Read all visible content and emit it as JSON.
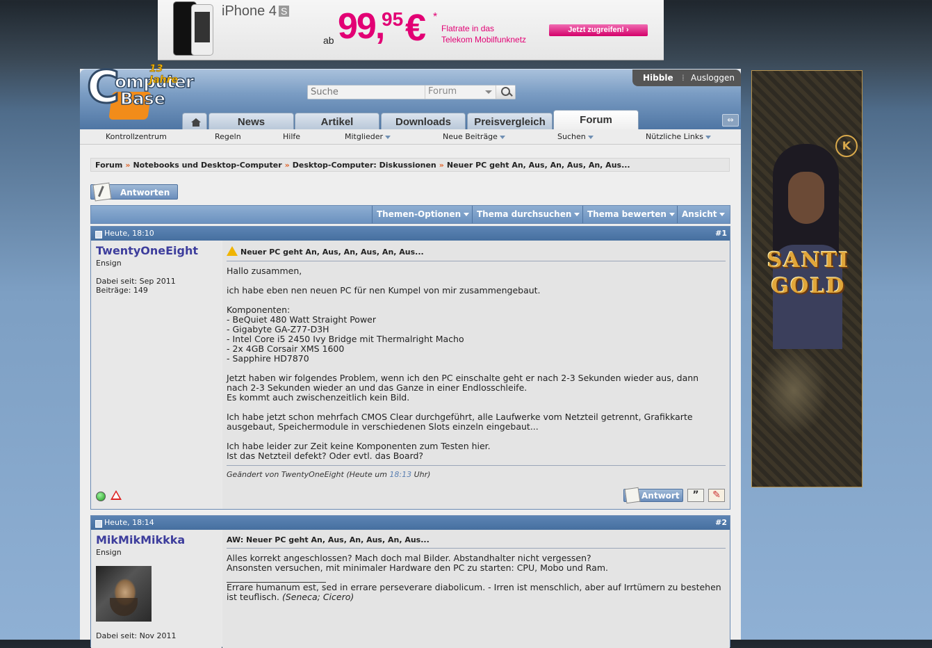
{
  "ad_top": {
    "product": "iPhone 4",
    "product_suffix": "S",
    "price_prefix": "ab",
    "price_main": "99,",
    "price_cents": "95",
    "currency": "€",
    "asterisk": "*",
    "tagline_1": "Flatrate in das",
    "tagline_2": "Telekom Mobilfunknetz",
    "cta": "Jetzt zugreifen!   ›",
    "brand_color": "#e20074"
  },
  "ad_side": {
    "title_line_1": "SANTI",
    "title_line_2": "GOLD",
    "badge": "K"
  },
  "logo": {
    "line_1": "omputer",
    "line_2": "ase",
    "letter_c": "C",
    "letter_b": "B",
    "anniversary": "13 Jahre"
  },
  "search": {
    "placeholder": "Suche",
    "scope": "Forum"
  },
  "user_bar": {
    "username": "Hibble",
    "separator": "⁞",
    "logout": "Ausloggen"
  },
  "main_nav": {
    "tabs": [
      {
        "label": "News"
      },
      {
        "label": "Artikel"
      },
      {
        "label": "Downloads"
      },
      {
        "label": "Preisvergleich"
      },
      {
        "label": "Forum"
      }
    ],
    "expand_icon": "⇔"
  },
  "sub_nav": {
    "items": [
      {
        "label": "Kontrollzentrum"
      },
      {
        "label": "Regeln"
      },
      {
        "label": "Hilfe"
      },
      {
        "label": "Mitglieder"
      },
      {
        "label": "Neue Beiträge"
      },
      {
        "label": "Suchen"
      },
      {
        "label": "Nützliche Links"
      }
    ]
  },
  "breadcrumb": {
    "separator": "»",
    "items": [
      {
        "label": "Forum"
      },
      {
        "label": "Notebooks und Desktop-Computer"
      },
      {
        "label": "Desktop-Computer: Diskussionen"
      },
      {
        "label": "Neuer PC geht An, Aus, An, Aus, An, Aus..."
      }
    ]
  },
  "reply_button": "Antworten",
  "thread_tools": [
    {
      "label": "Themen-Optionen"
    },
    {
      "label": "Thema durchsuchen"
    },
    {
      "label": "Thema bewerten"
    },
    {
      "label": "Ansicht"
    }
  ],
  "posts": [
    {
      "date": "Heute, 18:10",
      "number": "#1",
      "username": "TwentyOneEight",
      "rank": "Ensign",
      "joined": "Dabei seit: Sep 2011",
      "post_count": "Beiträge: 149",
      "title": "Neuer PC geht An, Aus, An, Aus, An, Aus...",
      "body": "Hallo zusammen,\n\nich habe eben nen neuen PC für nen Kumpel von mir zusammengebaut.\n\nKomponenten:\n- BeQuiet 480 Watt Straight Power\n- Gigabyte GA-Z77-D3H\n- Intel Core i5 2450 Ivy Bridge mit Thermalright Macho\n- 2x 4GB Corsair XMS 1600\n- Sapphire HD7870\n\nJetzt haben wir folgendes Problem, wenn ich den PC einschalte geht er nach 2-3 Sekunden wieder aus, dann\nnach 2-3 Sekunden wieder an und das Ganze in einer Endlosschleife.\nEs kommt auch zwischenzeitlich kein Bild.\n\nIch habe jetzt schon mehrfach CMOS Clear durchgeführt, alle Laufwerke vom Netzteil getrennt, Grafikkarte\nausgebaut, Speichermodule in verschiedenen Slots einzeln eingebaut...\n\nIch habe leider zur Zeit keine Komponenten zum Testen hier.\nIst das Netzteil defekt? Oder evtl. das Board?",
      "edit_prefix": "Geändert von TwentyOneEight (Heute um ",
      "edit_time": "18:13",
      "edit_suffix": " Uhr)",
      "reply_label": "Antwort"
    },
    {
      "date": "Heute, 18:14",
      "number": "#2",
      "username": "MikMikMikkka",
      "rank": "Ensign",
      "joined": "Dabei seit: Nov 2011",
      "title": "AW: Neuer PC geht An, Aus, An, Aus, An, Aus...",
      "body": "Alles korrekt angeschlossen? Mach doch mal Bilder. Abstandhalter nicht vergessen?\nAnsonsten versuchen, mit minimaler Hardware den PC zu starten: CPU, Mobo und Ram.",
      "signature": "Errare humanum est, sed in errare perseverare diabolicum. - Irren ist menschlich, aber auf Irrtümern zu bestehen\nist teuflisch. ",
      "signature_source": "(Seneca; Cicero)"
    }
  ]
}
